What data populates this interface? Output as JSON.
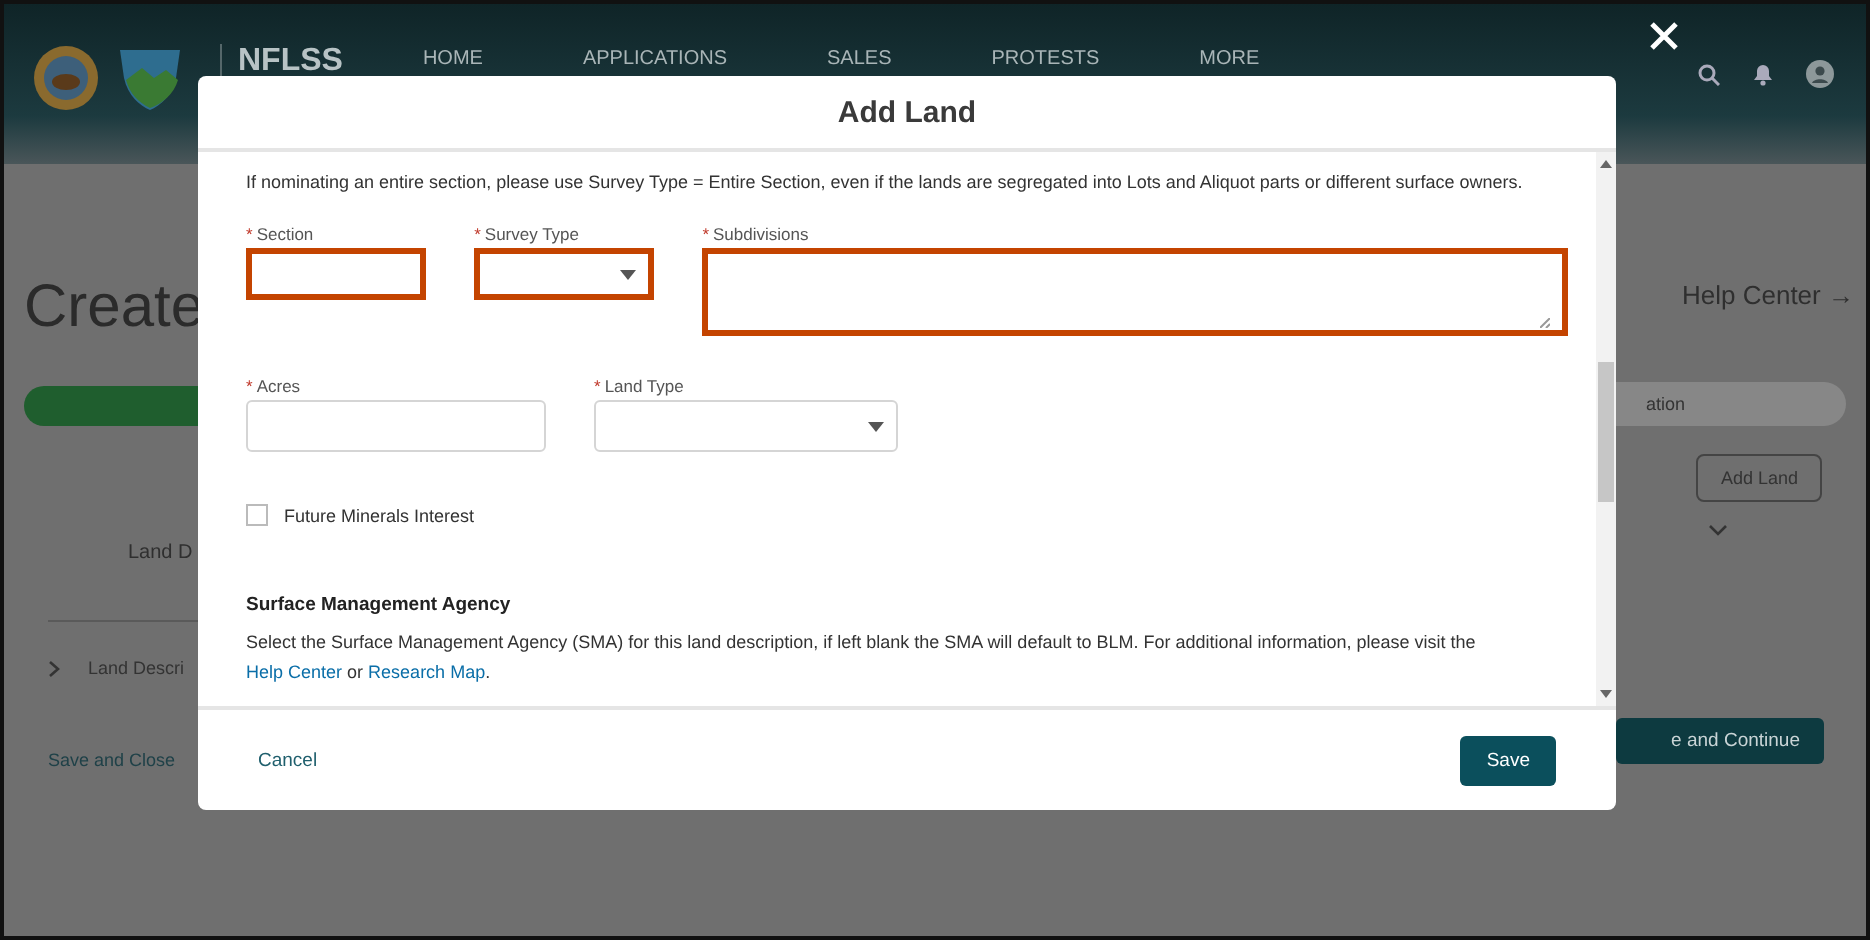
{
  "header": {
    "brand": "NFLSS",
    "nav": [
      {
        "label": "HOME"
      },
      {
        "label": "APPLICATIONS"
      },
      {
        "label": "SALES"
      },
      {
        "label": "PROTESTS"
      },
      {
        "label": "MORE"
      }
    ]
  },
  "page": {
    "title": "Create",
    "help_link": "Help Center →",
    "progress_step": "ation",
    "add_button": "Add Land",
    "column_header": "Land D",
    "row_label": "Land Descri",
    "save_close": "Save and Close",
    "continue_button": "e and Continue"
  },
  "modal": {
    "title": "Add Land",
    "intro": "If nominating an entire section, please use Survey Type = Entire Section, even if the lands are segregated into Lots and Aliquot parts or different surface owners.",
    "fields_row_1": [
      {
        "kind": "input",
        "label": "Section",
        "required_mark": "*",
        "highlighted": true
      },
      {
        "kind": "select",
        "label": "Survey Type",
        "required_mark": "*",
        "highlighted": true
      },
      {
        "kind": "textarea",
        "label": "Subdivisions",
        "required_mark": "*",
        "highlighted": true
      }
    ],
    "fields_row_2": [
      {
        "kind": "input",
        "label": "Acres",
        "required_mark": "*",
        "highlighted": false
      },
      {
        "kind": "select",
        "label": "Land Type",
        "required_mark": "*",
        "highlighted": false
      }
    ],
    "checkbox": {
      "label": "Future Minerals Interest",
      "checked": false
    },
    "sma_heading": "Surface Management Agency",
    "sma_paragraph": [
      {
        "kind": "text",
        "text": "Select the Surface Management Agency (SMA) for this land description, if left blank the SMA will default to BLM. For additional information, please visit the "
      },
      {
        "kind": "link",
        "text": "Help Center"
      },
      {
        "kind": "text",
        "text": " or "
      },
      {
        "kind": "link",
        "text": "Research Map"
      },
      {
        "kind": "text",
        "text": "."
      }
    ],
    "cancel": "Cancel",
    "save": "Save"
  }
}
